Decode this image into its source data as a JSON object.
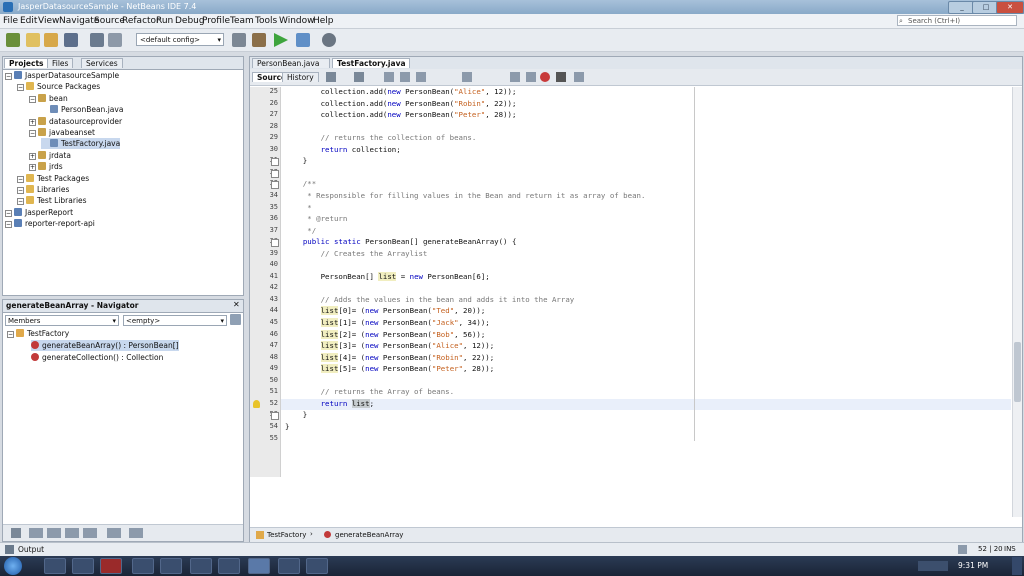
{
  "window": {
    "title": "JasperDatasourceSample - NetBeans IDE 7.4"
  },
  "menubar": [
    "File",
    "Edit",
    "View",
    "Navigate",
    "Source",
    "Refactor",
    "Run",
    "Debug",
    "Profile",
    "Team",
    "Tools",
    "Window",
    "Help"
  ],
  "search": {
    "placeholder": "Search (Ctrl+I)"
  },
  "toolbar": {
    "config": "<default config>"
  },
  "projects_panel": {
    "tabs": [
      "Projects",
      "Files",
      "Services"
    ],
    "tree": [
      {
        "label": "JasperDatasourceSample",
        "level": 0,
        "kind": "project"
      },
      {
        "label": "Source Packages",
        "level": 1,
        "kind": "folder"
      },
      {
        "label": "bean",
        "level": 2,
        "kind": "package"
      },
      {
        "label": "PersonBean.java",
        "level": 3,
        "kind": "java"
      },
      {
        "label": "datasourceprovider",
        "level": 2,
        "kind": "package"
      },
      {
        "label": "javabeanset",
        "level": 2,
        "kind": "package"
      },
      {
        "label": "TestFactory.java",
        "level": 3,
        "kind": "java",
        "selected": true
      },
      {
        "label": "jrdata",
        "level": 2,
        "kind": "package"
      },
      {
        "label": "jrds",
        "level": 2,
        "kind": "package"
      },
      {
        "label": "Test Packages",
        "level": 1,
        "kind": "folder"
      },
      {
        "label": "Libraries",
        "level": 1,
        "kind": "folder"
      },
      {
        "label": "Test Libraries",
        "level": 1,
        "kind": "folder"
      },
      {
        "label": "JasperReport",
        "level": 0,
        "kind": "project"
      },
      {
        "label": "reporter-report-api",
        "level": 0,
        "kind": "project"
      }
    ]
  },
  "navigator": {
    "title": "generateBeanArray - Navigator",
    "filter": "Members",
    "scope": "<empty>",
    "root": "TestFactory",
    "items": [
      "generateBeanArray() : PersonBean[]",
      "generateCollection() : Collection"
    ]
  },
  "editor": {
    "tabs": [
      "PersonBean.java",
      "TestFactory.java"
    ],
    "view_tabs": [
      "Source",
      "History"
    ],
    "lines": [
      {
        "n": "25",
        "text": "        collection.add(new PersonBean(\"Alice\", 12));"
      },
      {
        "n": "26",
        "text": "        collection.add(new PersonBean(\"Robin\", 22));"
      },
      {
        "n": "27",
        "text": "        collection.add(new PersonBean(\"Peter\", 28));"
      },
      {
        "n": "28",
        "text": ""
      },
      {
        "n": "29",
        "text": "        // returns the collection of beans."
      },
      {
        "n": "30",
        "text": "        return collection;"
      },
      {
        "n": "31",
        "text": "    }"
      },
      {
        "n": "32",
        "text": ""
      },
      {
        "n": "33",
        "text": "    /**"
      },
      {
        "n": "34",
        "text": "     * Responsible for filling values in the Bean and return it as array of bean."
      },
      {
        "n": "35",
        "text": "     *"
      },
      {
        "n": "36",
        "text": "     * @return"
      },
      {
        "n": "37",
        "text": "     */"
      },
      {
        "n": "38",
        "text": "    public static PersonBean[] generateBeanArray() {"
      },
      {
        "n": "39",
        "text": "        // Creates the Arraylist"
      },
      {
        "n": "40",
        "text": ""
      },
      {
        "n": "41",
        "text": "        PersonBean[] list = new PersonBean[6];"
      },
      {
        "n": "42",
        "text": ""
      },
      {
        "n": "43",
        "text": "        // Adds the values in the bean and adds it into the Array"
      },
      {
        "n": "44",
        "text": "        list[0]= (new PersonBean(\"Ted\", 20));"
      },
      {
        "n": "45",
        "text": "        list[1]= (new PersonBean(\"Jack\", 34));"
      },
      {
        "n": "46",
        "text": "        list[2]= (new PersonBean(\"Bob\", 56));"
      },
      {
        "n": "47",
        "text": "        list[3]= (new PersonBean(\"Alice\", 12));"
      },
      {
        "n": "48",
        "text": "        list[4]= (new PersonBean(\"Robin\", 22));"
      },
      {
        "n": "49",
        "text": "        list[5]= (new PersonBean(\"Peter\", 28));"
      },
      {
        "n": "50",
        "text": ""
      },
      {
        "n": "51",
        "text": "        // returns the Array of beans."
      },
      {
        "n": "52",
        "text": "        return list;"
      },
      {
        "n": "53",
        "text": "    }"
      },
      {
        "n": "54",
        "text": "}"
      },
      {
        "n": "55",
        "text": ""
      }
    ],
    "breadcrumbs": [
      "TestFactory",
      "generateBeanArray"
    ]
  },
  "statusbar": {
    "output": "Output",
    "position": "52 | 20",
    "mode": "INS"
  },
  "taskbar": {
    "time": "9:31 PM"
  }
}
